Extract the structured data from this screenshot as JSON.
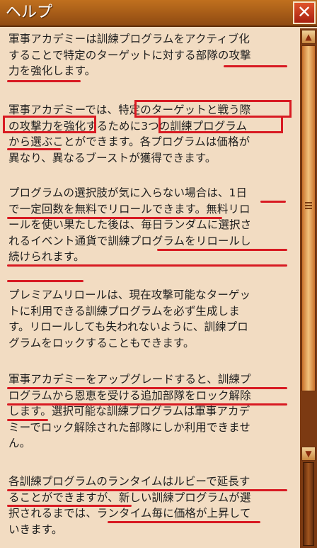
{
  "window": {
    "title": "ヘルプ",
    "close_label": "✕"
  },
  "help": {
    "paragraphs": [
      {
        "lines": [
          "軍事アカデミーは訓練プログラムをアクティブ化",
          "することで特定のターゲットに対する部隊の攻撃",
          "力を強化します。"
        ]
      },
      {
        "lines": [
          "軍事アカデミーでは、特定のターゲットと戦う際",
          "の攻撃力を強化するために3つの訓練プログラム",
          "から選ぶことができます。各プログラムは価格が",
          "異なり、異なるブーストが獲得できます。"
        ]
      },
      {
        "lines": [
          "プログラムの選択肢が気に入らない場合は、1日",
          "で一定回数を無料でリロールできます。無料リロ",
          "ールを使い果たした後は、毎日ランダムに選択さ",
          "れるイベント通貨で訓練プログラムをリロールし",
          "続けられます。"
        ]
      },
      {
        "lines": [
          "プレミアムリロールは、現在攻撃可能なターゲッ",
          "トに利用できる訓練プログラムを必ず生成しま",
          "す。リロールしても失われないように、訓練プロ",
          "グラムをロックすることもできます。"
        ]
      },
      {
        "lines": [
          "軍事アカデミーをアップグレードすると、訓練プ",
          "ログラムから恩恵を受ける追加部隊をロック解除",
          "します。選択可能な訓練プログラムは軍事アカデ",
          "ミーでロック解除された部隊にしか利用できませ",
          "ん。"
        ]
      },
      {
        "lines": [
          "各訓練プログラムのランタイムはルビーで延長す",
          "ることができますが、新しい訓練プログラムが選",
          "択されるまでは、ランタイム毎に価格が上昇して",
          "いきます。"
        ]
      }
    ]
  },
  "colors": {
    "highlight": "#d81a22",
    "background": "#f2dcc2",
    "titlebar": "#a85a18"
  },
  "scrollbar": {
    "up_icon": "▲",
    "down_icon": "▼"
  }
}
